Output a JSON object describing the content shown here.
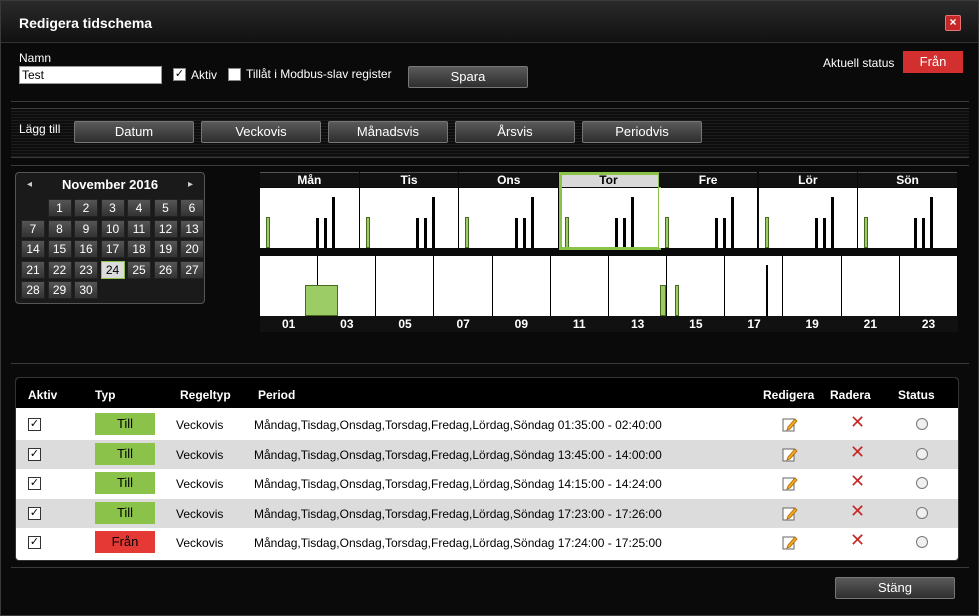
{
  "window": {
    "title": "Redigera tidschema",
    "close_label": "×"
  },
  "form": {
    "name_label": "Namn",
    "name_value": "Test",
    "active_label": "Aktiv",
    "active_checked": "✓",
    "modbus_label": "Tillåt i Modbus-slav register",
    "save_label": "Spara",
    "status_label": "Aktuell status",
    "status_value": "Från",
    "status_color": "#d32f2f"
  },
  "add_bar": {
    "label": "Lägg till",
    "buttons": [
      "Datum",
      "Veckovis",
      "Månadsvis",
      "Årsvis",
      "Periodvis"
    ]
  },
  "calendar": {
    "prev": "◂",
    "next": "▸",
    "month_label": "November 2016",
    "days": [
      "1",
      "2",
      "3",
      "4",
      "5",
      "6",
      "7",
      "8",
      "9",
      "10",
      "11",
      "12",
      "13",
      "14",
      "15",
      "16",
      "17",
      "18",
      "19",
      "20",
      "21",
      "22",
      "23",
      "24",
      "25",
      "26",
      "27",
      "28",
      "29",
      "30"
    ],
    "today": "24",
    "first_weekday_offset": 1
  },
  "week": {
    "days": [
      "Mån",
      "Tis",
      "Ons",
      "Tor",
      "Fre",
      "Lör",
      "Sön"
    ],
    "selected": "Tor"
  },
  "hours": {
    "labels": [
      "01",
      "03",
      "05",
      "07",
      "09",
      "11",
      "13",
      "15",
      "17",
      "19",
      "21",
      "23"
    ]
  },
  "table": {
    "headers": {
      "active": "Aktiv",
      "type": "Typ",
      "rule_type": "Regeltyp",
      "period": "Period",
      "edit": "Redigera",
      "delete": "Radera",
      "status": "Status"
    },
    "rows": [
      {
        "checked": "✓",
        "type": "Till",
        "type_state": "on",
        "rule": "Veckovis",
        "period": "Måndag,Tisdag,Onsdag,Torsdag,Fredag,Lördag,Söndag 01:35:00 - 02:40:00"
      },
      {
        "checked": "✓",
        "type": "Till",
        "type_state": "on",
        "rule": "Veckovis",
        "period": "Måndag,Tisdag,Onsdag,Torsdag,Fredag,Lördag,Söndag 13:45:00 - 14:00:00"
      },
      {
        "checked": "✓",
        "type": "Till",
        "type_state": "on",
        "rule": "Veckovis",
        "period": "Måndag,Tisdag,Onsdag,Torsdag,Fredag,Lördag,Söndag 14:15:00 - 14:24:00"
      },
      {
        "checked": "✓",
        "type": "Till",
        "type_state": "on",
        "rule": "Veckovis",
        "period": "Måndag,Tisdag,Onsdag,Torsdag,Fredag,Lördag,Söndag 17:23:00 - 17:26:00"
      },
      {
        "checked": "✓",
        "type": "Från",
        "type_state": "off",
        "rule": "Veckovis",
        "period": "Måndag,Tisdag,Onsdag,Torsdag,Fredag,Lördag,Söndag 17:24:00 - 17:25:00"
      }
    ]
  },
  "footer": {
    "close_label": "Stäng"
  },
  "colors": {
    "on": "#8bc34a",
    "off": "#e53935",
    "accent_select": "#8bc34a"
  }
}
